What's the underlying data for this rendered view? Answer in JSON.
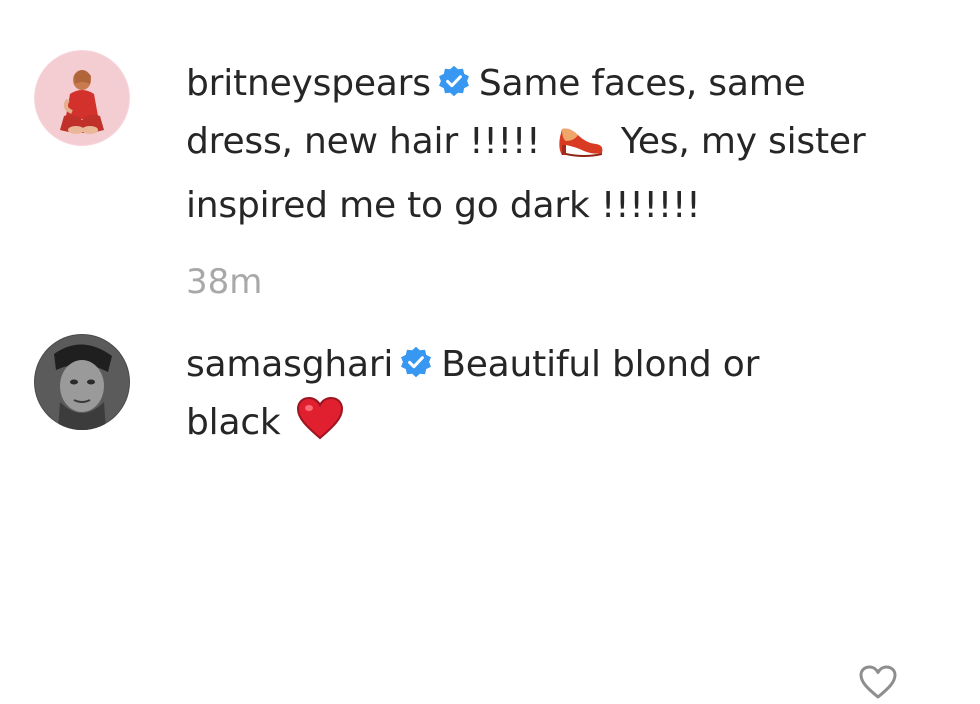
{
  "comments": [
    {
      "username": "britneyspears",
      "verified": true,
      "text_before_emoji": "Same faces, same dress, new hair !!!!!",
      "emoji": "high-heeled-shoe",
      "text_after_emoji": "Yes, my sister inspired me to go dark !!!!!!!",
      "timestamp": "38m"
    },
    {
      "username": "samasghari",
      "verified": true,
      "text_before_emoji": "Beautiful blond or black",
      "emoji": "red-heart",
      "text_after_emoji": ""
    }
  ],
  "colors": {
    "verified_badge": "#3897f0",
    "timestamp": "#a8a8a8",
    "text": "#262626",
    "like_icon": "#8e8e8e"
  }
}
